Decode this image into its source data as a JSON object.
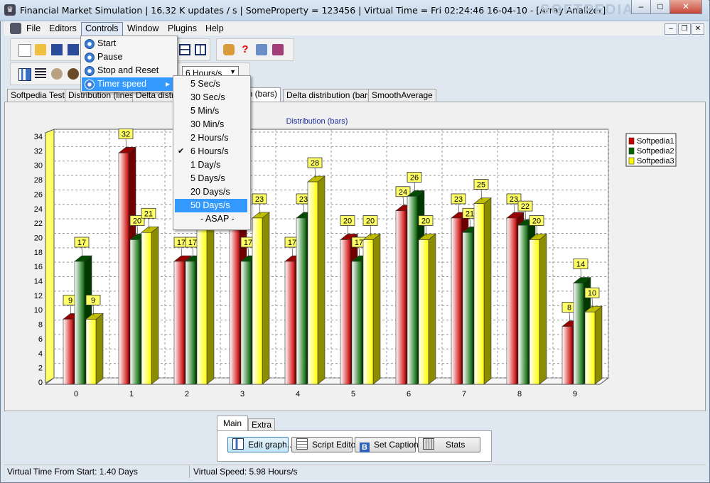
{
  "window": {
    "title": "Financial Market Simulation | 16.32 K updates / s | SomeProperty = 123456 | Virtual Time = Fri   02:24:46   16-04-10  - [Array Analizer]",
    "watermark": "SOFTPEDIA",
    "min_glyph": "–",
    "max_glyph": "□",
    "close_glyph": "✕"
  },
  "menubar": {
    "items": [
      "File",
      "Editors",
      "Controls",
      "Window",
      "Plugins",
      "Help"
    ],
    "mdi_min": "–",
    "mdi_restore": "❐",
    "mdi_close": "✕"
  },
  "controls_menu": {
    "items": [
      "Start",
      "Pause",
      "Stop and Reset",
      "Timer speed"
    ],
    "submenu_arrow": "▸"
  },
  "timer_speed_menu": {
    "items": [
      "5 Sec/s",
      "30 Sec/s",
      "5 Min/s",
      "30 Min/s",
      "2 Hours/s",
      "6 Hours/s",
      "1 Day/s",
      "5 Days/s",
      "20 Days/s",
      "50 Days/s",
      "- ASAP -"
    ],
    "checked_index": 5,
    "highlighted_index": 9,
    "check_glyph": "✔"
  },
  "speed_select": {
    "value": "6 Hours/s"
  },
  "tabs": [
    {
      "label": "Softpedia Test"
    },
    {
      "label": "Distribution (lines)"
    },
    {
      "label": "Delta distrib"
    },
    {
      "label": "on (bars)"
    },
    {
      "label": "Delta distribution (bars)"
    },
    {
      "label": "SmoothAverage"
    }
  ],
  "chart_data": {
    "type": "bar",
    "title": "Distribution (bars)",
    "categories": [
      "0",
      "1",
      "2",
      "3",
      "4",
      "5",
      "6",
      "7",
      "8",
      "9"
    ],
    "series": [
      {
        "name": "Softpedia1",
        "color": "#cc0000",
        "values": [
          9,
          32,
          17,
          23,
          17,
          20,
          24,
          23,
          23,
          8
        ]
      },
      {
        "name": "Softpedia2",
        "color": "#006600",
        "values": [
          17,
          20,
          17,
          17,
          23,
          17,
          26,
          21,
          22,
          14
        ]
      },
      {
        "name": "Softpedia3",
        "color": "#ffff00",
        "values": [
          9,
          21,
          23,
          23,
          28,
          20,
          20,
          25,
          20,
          10
        ]
      }
    ],
    "ylim": [
      0,
      34
    ],
    "yticks": [
      0,
      2,
      4,
      6,
      8,
      10,
      12,
      14,
      16,
      18,
      20,
      22,
      24,
      26,
      28,
      30,
      32,
      34
    ],
    "grid": true,
    "legend_position": "top-right"
  },
  "bottom_tabs": [
    {
      "label": "Main"
    },
    {
      "label": "Extra"
    }
  ],
  "bottom_buttons": [
    {
      "label": "Edit graph...",
      "icon": "chart-icon"
    },
    {
      "label": "Script Editor",
      "icon": "script-icon"
    },
    {
      "label": "Set Caption",
      "icon": "b-letter-icon"
    },
    {
      "label": "Stats",
      "icon": "calculator-icon"
    }
  ],
  "status": {
    "virtual_time": "Virtual Time From Start:  1.40  Days",
    "virtual_speed": "Virtual Speed:  5.98  Hours/s"
  }
}
